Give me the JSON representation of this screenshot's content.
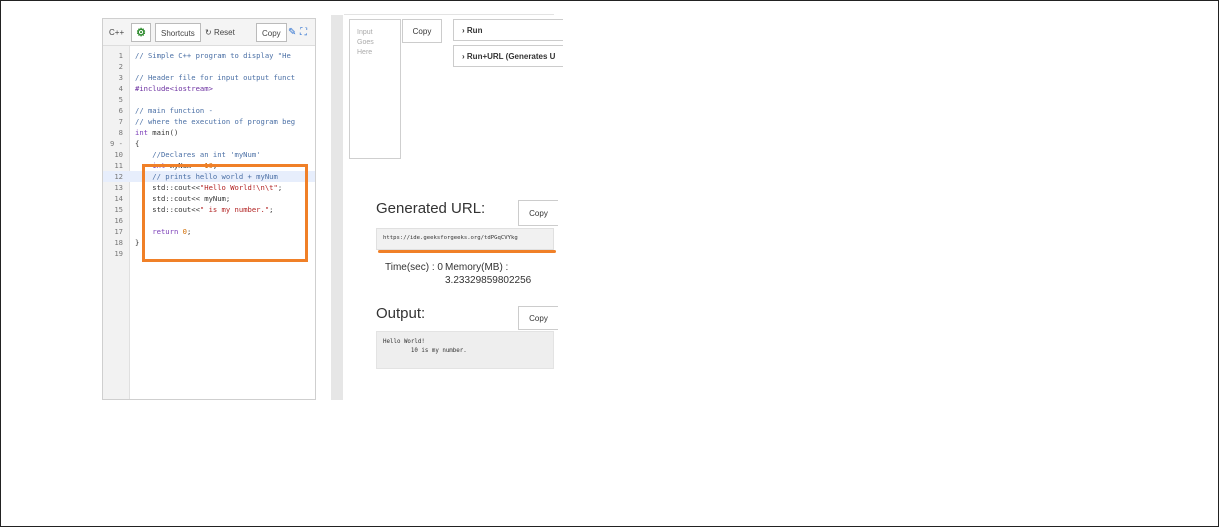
{
  "toolbar": {
    "language": "C++",
    "shortcuts": "Shortcuts",
    "reset": "Reset",
    "reset_icon": "↻",
    "copy": "Copy",
    "gear_icon": "⚙",
    "pencil_icon": "✎",
    "expand_icon": "⛶"
  },
  "code_lines": [
    {
      "n": "1",
      "text": "// Simple C++ program to display \"He"
    },
    {
      "n": "2",
      "text": ""
    },
    {
      "n": "3",
      "text": "// Header file for input output funct"
    },
    {
      "n": "4",
      "text": "#include<iostream>"
    },
    {
      "n": "5",
      "text": ""
    },
    {
      "n": "6",
      "text": "// main function -"
    },
    {
      "n": "7",
      "text": "// where the execution of program beg"
    },
    {
      "n": "8",
      "text": "int main()"
    },
    {
      "n": "9 -",
      "text": "{"
    },
    {
      "n": "10",
      "text": "    //Declares an int 'myNum'"
    },
    {
      "n": "11",
      "text": "    int myNum = 10;"
    },
    {
      "n": "12",
      "text": "    // prints hello world + myNum"
    },
    {
      "n": "13",
      "text": "    std::cout<<\"Hello World!\\n\\t\";"
    },
    {
      "n": "14",
      "text": "    std::cout<< myNum;"
    },
    {
      "n": "15",
      "text": "    std::cout<<\" is my number.\";"
    },
    {
      "n": "16",
      "text": ""
    },
    {
      "n": "17",
      "text": "    return 0;"
    },
    {
      "n": "18",
      "text": "}"
    },
    {
      "n": "19",
      "text": ""
    }
  ],
  "input": {
    "placeholder": "Input\nGoes\nHere",
    "copy": "Copy"
  },
  "run": {
    "run_label": "Run",
    "run_url_label": "Run+URL (Generates U",
    "chevron": "›"
  },
  "generated": {
    "title": "Generated URL:",
    "copy": "Copy",
    "url": "https://ide.geeksforgeeks.org/tdPGqCVYkg"
  },
  "stats": {
    "time": "Time(sec) : 0",
    "memory_label": "Memory(MB) :",
    "memory_value": "3.23329859802256"
  },
  "output": {
    "title": "Output:",
    "copy": "Copy",
    "text": "Hello World!\n        10 is my number."
  },
  "colors": {
    "accent": "#f08028",
    "comment": "#4a6fa5",
    "keyword": "#7a3db8",
    "string": "#b22222"
  }
}
